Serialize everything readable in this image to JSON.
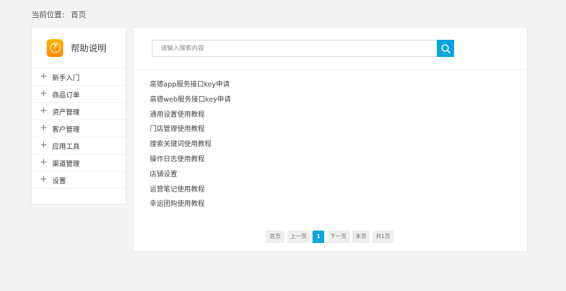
{
  "breadcrumb": {
    "label": "当前位置:",
    "current": "首页"
  },
  "sidebar": {
    "title": "帮助说明",
    "items": [
      {
        "label": "新手入门"
      },
      {
        "label": "商品订单"
      },
      {
        "label": "资产管理"
      },
      {
        "label": "客户管理"
      },
      {
        "label": "应用工具"
      },
      {
        "label": "渠道管理"
      },
      {
        "label": "设置"
      }
    ]
  },
  "search": {
    "placeholder": "请输入搜索内容",
    "value": ""
  },
  "articles": [
    "高德app服务接口key申请",
    "高德web服务接口key申请",
    "通用设置使用教程",
    "门店管理使用教程",
    "搜索关键词使用教程",
    "操作日志使用教程",
    "店铺设置",
    "运营笔记使用教程",
    "幸运团购使用教程"
  ],
  "pagination": {
    "first": "首页",
    "prev": "上一页",
    "current": "1",
    "next": "下一页",
    "last": "末页",
    "total": "共1页"
  },
  "colors": {
    "accent": "#0aa5df",
    "icon_orange": "#ff9a00",
    "background": "#f3f3f3"
  },
  "icons": {
    "help": "question-circle-icon",
    "search": "search-icon",
    "expand": "plus-icon"
  }
}
